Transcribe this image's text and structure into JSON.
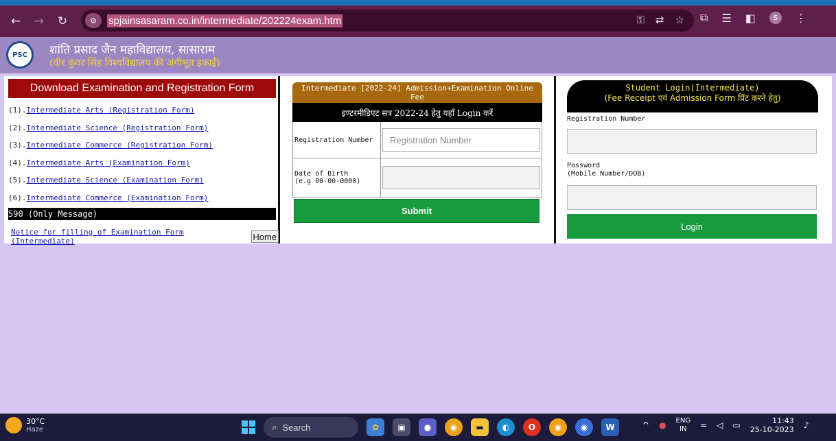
{
  "browser": {
    "url": "spjainsasaram.co.in/intermediate/202224exam.htm",
    "avatar_letter": "S"
  },
  "site": {
    "college_name": "शांति प्रसाद जैन महाविद्यालय, सासाराम",
    "college_subtitle": "(वीर कुंवर सिंह विश्वविद्यालय की अंगीभूत इकाई)",
    "logo_text": "PSC"
  },
  "left": {
    "title": "Download Examination and Registration Form",
    "forms": [
      {
        "num": "(1). ",
        "label": "Intermediate Arts (Registration Form)"
      },
      {
        "num": "(2). ",
        "label": "Intermediate Science (Registration Form)"
      },
      {
        "num": "(3). ",
        "label": "Intermediate Commerce (Registration Form)"
      },
      {
        "num": "(4). ",
        "label": "Intermediate Arts (Examination Form)"
      },
      {
        "num": "(5). ",
        "label": "Intermediate Science (Examination Form)"
      },
      {
        "num": "(6). ",
        "label": "Intermediate Commerce (Examination Form)"
      }
    ],
    "message": "590 (Only Message)",
    "notice_link": "Notice for filling of Examination Form (Intermediate)",
    "home_label": "Home"
  },
  "middle": {
    "title_line1": "Intermediate [2022-24] Admission+Examination Online Fee",
    "title_line2": "इण्टरमीडिएट सत्र 2022-24 हेतु यहाँ Login करें",
    "reg_label": "Registration Number",
    "reg_placeholder": "Registration Number",
    "dob_label_1": "Date of Birth",
    "dob_label_2": "(e.g 00-00-0000)",
    "submit_label": "Submit"
  },
  "right": {
    "title_line1": "Student Login(Intermediate)",
    "title_line2": "(Fee Receipt एवं Admission Form प्रिंट करने हेतु)",
    "reg_label": "Registration Number",
    "password_label_1": "Password",
    "password_label_2": "(Mobile Number/DOB)",
    "login_label": "Login"
  },
  "taskbar": {
    "temperature": "30°C",
    "weather": "Haze",
    "search_label": "Search",
    "lang_1": "ENG",
    "lang_2": "IN",
    "time": "11:43",
    "date": "25-10-2023"
  }
}
